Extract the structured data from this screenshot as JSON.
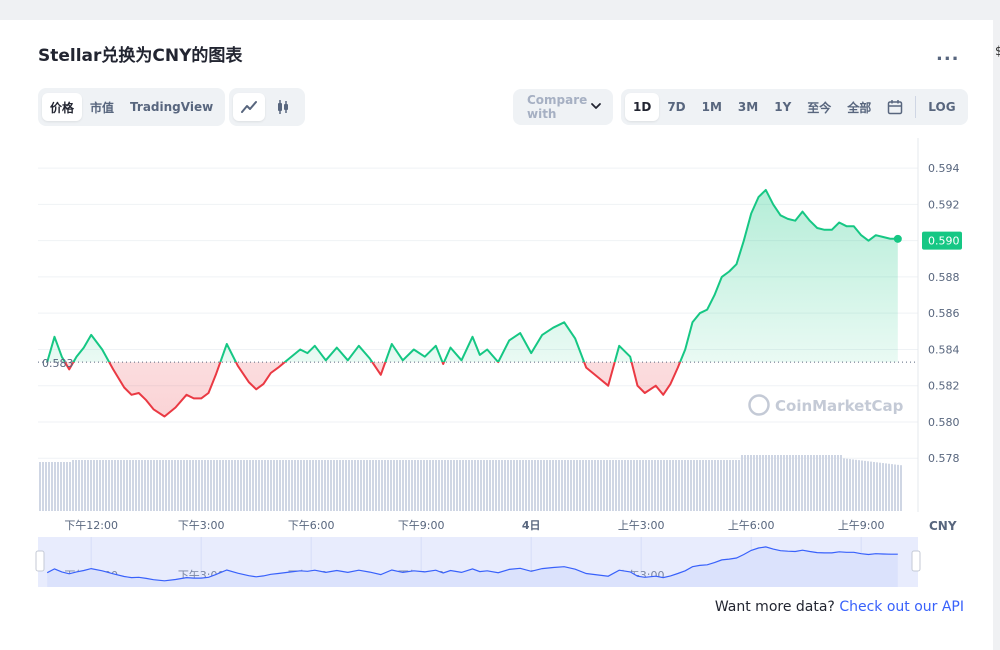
{
  "title": "Stellar兑换为CNY的图表",
  "more_label": "...",
  "edge_glyph": "$",
  "view_tabs": [
    {
      "label": "价格",
      "active": true
    },
    {
      "label": "市值",
      "active": false
    },
    {
      "label": "TradingView",
      "active": false
    }
  ],
  "chart_type_icons": [
    {
      "name": "line-chart-icon",
      "active": true
    },
    {
      "name": "candlestick-icon",
      "active": false
    }
  ],
  "compare_label": "Compare with",
  "range_tabs": [
    {
      "label": "1D",
      "active": true
    },
    {
      "label": "7D",
      "active": false
    },
    {
      "label": "1M",
      "active": false
    },
    {
      "label": "3M",
      "active": false
    },
    {
      "label": "1Y",
      "active": false
    },
    {
      "label": "至今",
      "active": false
    },
    {
      "label": "全部",
      "active": false
    }
  ],
  "log_label": "LOG",
  "colors": {
    "up": "#16c784",
    "down": "#ea3943",
    "volume": "#cfd6e4",
    "navigator_line": "#3861fb",
    "navigator_fill": "#e8ecfd"
  },
  "chart_data": {
    "type": "line",
    "currency_label": "CNY",
    "reference_value": "0.583",
    "current_value": "0.590",
    "watermark": "CoinMarketCap",
    "ylim": [
      0.5768,
      0.595
    ],
    "yticks": [
      "0.594",
      "0.592",
      "0.590",
      "0.588",
      "0.586",
      "0.584",
      "0.582",
      "0.580",
      "0.578"
    ],
    "xticks": [
      "下午12:00",
      "下午3:00",
      "下午6:00",
      "下午9:00",
      "4日",
      "上午3:00",
      "上午6:00",
      "上午9:00"
    ],
    "x_start_hour": 10.55,
    "x_end_hour": 34.55,
    "series": [
      {
        "x": [
          10.8,
          11.0,
          11.2,
          11.4,
          11.6,
          11.8,
          12.0,
          12.3,
          12.6,
          12.9,
          13.1,
          13.3,
          13.5,
          13.7,
          14.0,
          14.3,
          14.6,
          14.8,
          15.0,
          15.2,
          15.4,
          15.7,
          16.0,
          16.3,
          16.5,
          16.7,
          16.9,
          17.1,
          17.4,
          17.7,
          17.9,
          18.1,
          18.4,
          18.7,
          19.0,
          19.3,
          19.6,
          19.9,
          20.2,
          20.5,
          20.8,
          21.1,
          21.4,
          21.6,
          21.8,
          22.1,
          22.4,
          22.6,
          22.8,
          23.1,
          23.4,
          23.7,
          24.0,
          24.3,
          24.6,
          24.9,
          25.2,
          25.5,
          25.8,
          26.1,
          26.4,
          26.7,
          26.9,
          27.1,
          27.4,
          27.6,
          27.8,
          28.0,
          28.2,
          28.4,
          28.6,
          28.8,
          29.0,
          29.2,
          29.4,
          29.6,
          29.8,
          30.0,
          30.2,
          30.4,
          30.6,
          30.8,
          31.0,
          31.2,
          31.4,
          31.6,
          31.8,
          32.0,
          32.2,
          32.4,
          32.6,
          32.8,
          33.0,
          33.2,
          33.4,
          33.6,
          33.8,
          34.0
        ],
        "y": [
          0.5833,
          0.5847,
          0.5836,
          0.5829,
          0.5836,
          0.5841,
          0.5848,
          0.584,
          0.5829,
          0.5819,
          0.5815,
          0.5816,
          0.5812,
          0.5807,
          0.5803,
          0.5808,
          0.5815,
          0.5813,
          0.5813,
          0.5816,
          0.5826,
          0.5843,
          0.5831,
          0.5822,
          0.5818,
          0.5821,
          0.5827,
          0.583,
          0.5835,
          0.584,
          0.5838,
          0.5842,
          0.5834,
          0.5841,
          0.5834,
          0.5842,
          0.5835,
          0.5826,
          0.5843,
          0.5834,
          0.584,
          0.5836,
          0.5842,
          0.5832,
          0.5841,
          0.5834,
          0.5847,
          0.5837,
          0.584,
          0.5833,
          0.5845,
          0.5849,
          0.5838,
          0.5848,
          0.5852,
          0.5855,
          0.5846,
          0.583,
          0.5825,
          0.582,
          0.5842,
          0.5836,
          0.582,
          0.5816,
          0.582,
          0.5815,
          0.5821,
          0.583,
          0.584,
          0.5855,
          0.586,
          0.5862,
          0.587,
          0.588,
          0.5883,
          0.5887,
          0.59,
          0.5915,
          0.5924,
          0.5928,
          0.592,
          0.5914,
          0.5912,
          0.5911,
          0.5916,
          0.5911,
          0.5907,
          0.5906,
          0.5906,
          0.591,
          0.5908,
          0.5908,
          0.5903,
          0.59,
          0.5903,
          0.5902,
          0.5901,
          0.5901
        ]
      }
    ]
  }
}
